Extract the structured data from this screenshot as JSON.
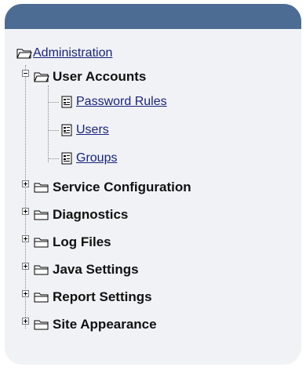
{
  "tree": {
    "root_label": "Administration",
    "user_accounts": {
      "label": "User Accounts",
      "children": [
        " Password Rules",
        " Users",
        " Groups"
      ]
    },
    "collapsed_items": [
      "Service Configuration",
      "Diagnostics",
      "Log Files",
      "Java Settings",
      "Report Settings",
      "Site Appearance"
    ]
  },
  "colors": {
    "header": "#4d6c94",
    "panel": "#f0f2f6",
    "link": "#1a237e"
  },
  "icons": {
    "root": "open-folder-icon",
    "expanded_folder": "open-folder-icon",
    "page": "page-icon",
    "collapsed_folder": "folder-icon"
  }
}
